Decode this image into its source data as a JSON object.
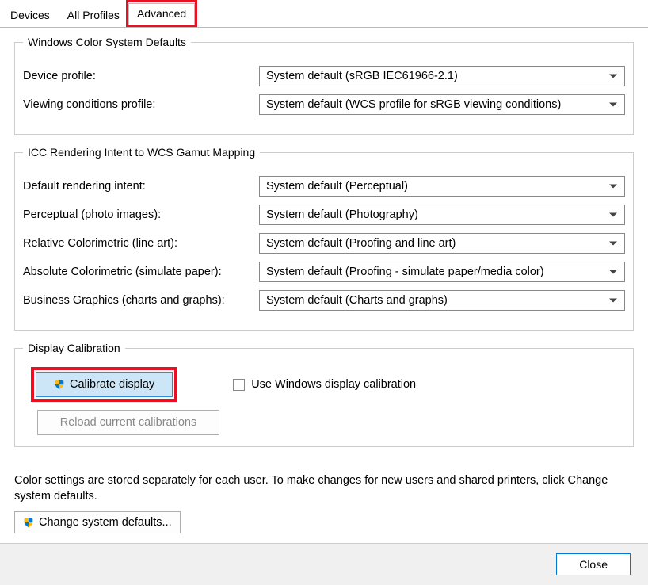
{
  "tabs": {
    "devices": "Devices",
    "allProfiles": "All Profiles",
    "advanced": "Advanced"
  },
  "group1": {
    "legend": "Windows Color System Defaults",
    "deviceProfileLabel": "Device profile:",
    "deviceProfileValue": "System default (sRGB IEC61966-2.1)",
    "viewingConditionsLabel": "Viewing conditions profile:",
    "viewingConditionsValue": "System default (WCS profile for sRGB viewing conditions)"
  },
  "group2": {
    "legend": "ICC Rendering Intent to WCS Gamut Mapping",
    "defaultIntentLabel": "Default rendering intent:",
    "defaultIntentValue": "System default (Perceptual)",
    "perceptualLabel": "Perceptual (photo images):",
    "perceptualValue": "System default (Photography)",
    "relativeLabel": "Relative Colorimetric (line art):",
    "relativeValue": "System default (Proofing and line art)",
    "absoluteLabel": "Absolute Colorimetric (simulate paper):",
    "absoluteValue": "System default (Proofing - simulate paper/media color)",
    "businessLabel": "Business Graphics (charts and graphs):",
    "businessValue": "System default (Charts and graphs)"
  },
  "group3": {
    "legend": "Display Calibration",
    "calibrateBtn": "Calibrate display",
    "useWindowsCalib": "Use Windows display calibration",
    "reloadBtn": "Reload current calibrations"
  },
  "footer": {
    "note": "Color settings are stored separately for each user. To make changes for new users and shared printers, click Change system defaults.",
    "changeDefaultsBtn": "Change system defaults..."
  },
  "bottom": {
    "close": "Close"
  }
}
